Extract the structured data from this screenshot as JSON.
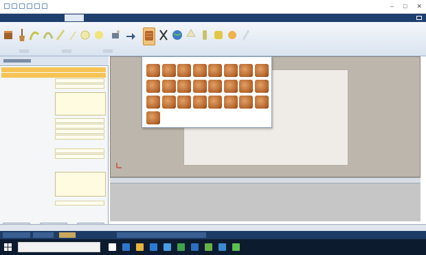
{
  "window": {
    "title": "",
    "controls": {
      "minimize": "–",
      "maximize": "□",
      "close": "✕"
    }
  },
  "ribbon": {
    "tabs": [
      {
        "label": ""
      },
      {
        "label": ""
      },
      {
        "label": ""
      },
      {
        "label": "",
        "active": true
      },
      {
        "label": ""
      }
    ]
  },
  "gallery": {
    "title": "",
    "item_icon": "wood-texture-icon",
    "item_count": 25
  },
  "colors": {
    "ribbon_tab_bar": "#1f3f6e",
    "selected_row": "#f6c454",
    "wood": "#c7793a",
    "canvas_bg": "#bdb6ad",
    "taskbar": "#0d1b2e"
  },
  "taskbar": {
    "search_placeholder": "",
    "time": "",
    "date": ""
  }
}
